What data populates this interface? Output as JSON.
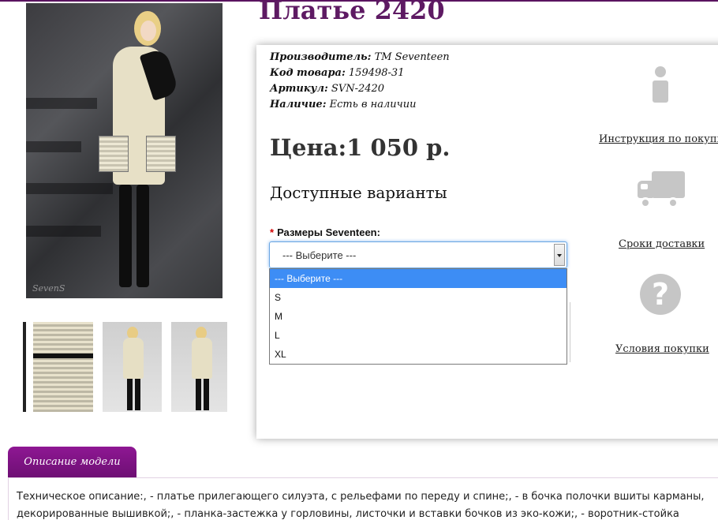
{
  "product": {
    "title": "Платье 2420",
    "photo_watermark": "SevenS",
    "info": [
      {
        "label": "Производитель:",
        "value": "ТМ Seventeen"
      },
      {
        "label": "Код товара:",
        "value": "159498-31"
      },
      {
        "label": "Артикул:",
        "value": "SVN-2420"
      },
      {
        "label": "Наличие:",
        "value": "Есть в наличии"
      }
    ],
    "price_label": "Цена:",
    "price_value": "1 050 р.",
    "variants_title": "Доступные варианты",
    "size_select": {
      "required_mark": "*",
      "label": "Размеры Seventeen:",
      "selected": "--- Выберите ---",
      "options": [
        "--- Выберите ---",
        "S",
        "M",
        "L",
        "XL"
      ],
      "highlighted_index": 0
    }
  },
  "side_links": {
    "instructions": "Инструкция по покупке",
    "delivery": "Сроки доставки",
    "terms": "Условия покупки"
  },
  "side_icons": [
    "info-icon",
    "truck-icon",
    "question-icon"
  ],
  "tabs": {
    "description_label": "Описание модели"
  },
  "description": {
    "text": "Техническое описание:, - платье прилегающего силуэта, с рельефами по переду и спине;, - в бочка полочки вшиты карманы, декорированные вышивкой;, - планка-застежка у горловины, листочки и вставки бочков из эко-кожи;, - воротник-стойка"
  },
  "colors": {
    "brand_purple": "#5e1a63",
    "tab_purple": "#8e1793",
    "option_highlight": "#3d8df5",
    "required_red": "#d10000"
  }
}
